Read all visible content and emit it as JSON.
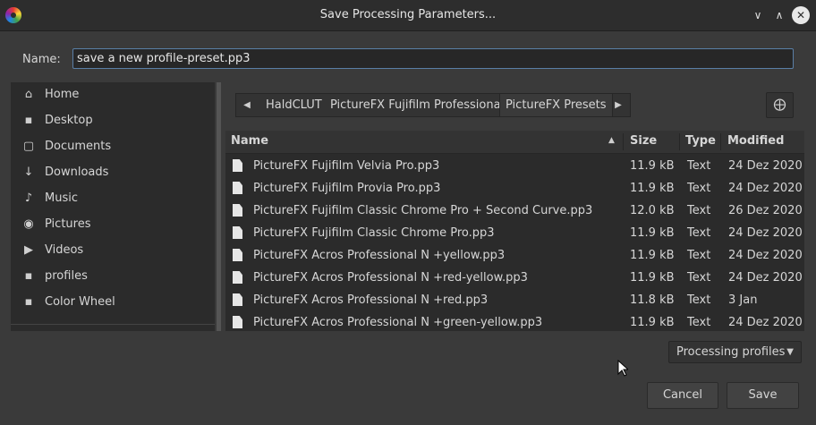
{
  "window": {
    "title": "Save Processing Parameters..."
  },
  "name_field": {
    "label": "Name:",
    "value": "save a new profile-preset.pp3"
  },
  "sidebar": {
    "items": [
      {
        "label": "Home",
        "icon": "home-icon"
      },
      {
        "label": "Desktop",
        "icon": "folder-icon"
      },
      {
        "label": "Documents",
        "icon": "document-icon"
      },
      {
        "label": "Downloads",
        "icon": "download-icon"
      },
      {
        "label": "Music",
        "icon": "music-icon"
      },
      {
        "label": "Pictures",
        "icon": "camera-icon"
      },
      {
        "label": "Videos",
        "icon": "video-icon"
      },
      {
        "label": "profiles",
        "icon": "folder-icon"
      },
      {
        "label": "Color Wheel",
        "icon": "folder-icon"
      }
    ]
  },
  "pathbar": {
    "crumbs": [
      "HaldCLUT",
      "PictureFX Fujifilm Professional",
      "PictureFX Presets"
    ]
  },
  "filelist": {
    "columns": [
      "Name",
      "Size",
      "Type",
      "Modified"
    ],
    "sort_column": "Name",
    "rows": [
      {
        "name": "PictureFX Fujifilm Velvia Pro.pp3",
        "size": "11.9 kB",
        "type": "Text",
        "modified": "24 Dez 2020"
      },
      {
        "name": "PictureFX Fujifilm Provia Pro.pp3",
        "size": "11.9 kB",
        "type": "Text",
        "modified": "24 Dez 2020"
      },
      {
        "name": "PictureFX Fujifilm Classic Chrome Pro + Second Curve.pp3",
        "size": "12.0 kB",
        "type": "Text",
        "modified": "26 Dez 2020"
      },
      {
        "name": "PictureFX Fujifilm Classic Chrome Pro.pp3",
        "size": "11.9 kB",
        "type": "Text",
        "modified": "24 Dez 2020"
      },
      {
        "name": "PictureFX Acros Professional N +yellow.pp3",
        "size": "11.9 kB",
        "type": "Text",
        "modified": "24 Dez 2020"
      },
      {
        "name": "PictureFX Acros Professional N +red-yellow.pp3",
        "size": "11.9 kB",
        "type": "Text",
        "modified": "24 Dez 2020"
      },
      {
        "name": "PictureFX Acros Professional N +red.pp3",
        "size": "11.8 kB",
        "type": "Text",
        "modified": "3 Jan"
      },
      {
        "name": "PictureFX Acros Professional N +green-yellow.pp3",
        "size": "11.9 kB",
        "type": "Text",
        "modified": "24 Dez 2020"
      }
    ]
  },
  "filter": {
    "selected": "Processing profiles"
  },
  "buttons": {
    "cancel": "Cancel",
    "save": "Save"
  },
  "colors": {
    "background": "#3a3a3a",
    "panel": "#2b2b2b",
    "titlebar": "#2d2d2d",
    "focus_border": "#5a7fa6"
  }
}
